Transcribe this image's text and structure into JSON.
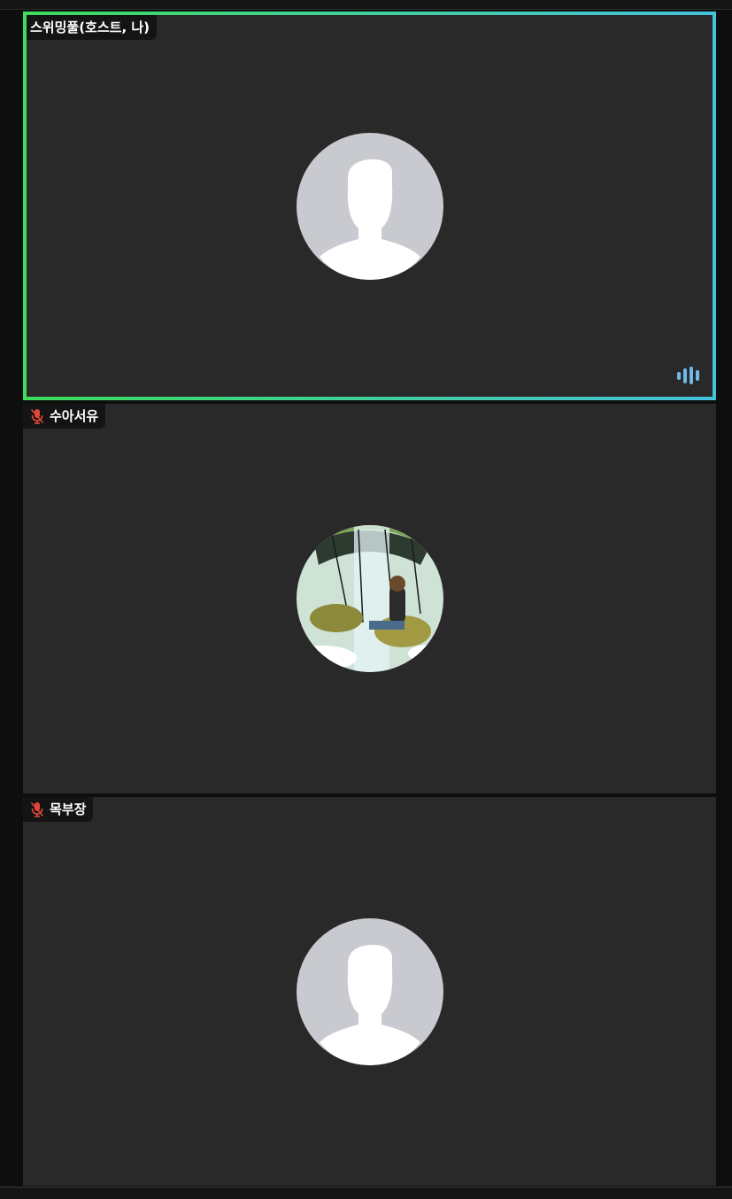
{
  "participants": [
    {
      "name": "스위밍풀(호스트, 나)",
      "avatar": "default-person-icon",
      "speaking": true,
      "muted": false
    },
    {
      "name": "수아서유",
      "avatar": "illustration-photo",
      "speaking": false,
      "muted": true
    },
    {
      "name": "목부장",
      "avatar": "default-person-icon",
      "speaking": false,
      "muted": true
    }
  ],
  "colors": {
    "tile_background": "#292929",
    "active_border_start": "#3ddc5c",
    "active_border_end": "#45c2dc",
    "muted_mic": "#e0463a",
    "audio_indicator": "#6fb8e8",
    "avatar_bg": "#c8cacf"
  }
}
